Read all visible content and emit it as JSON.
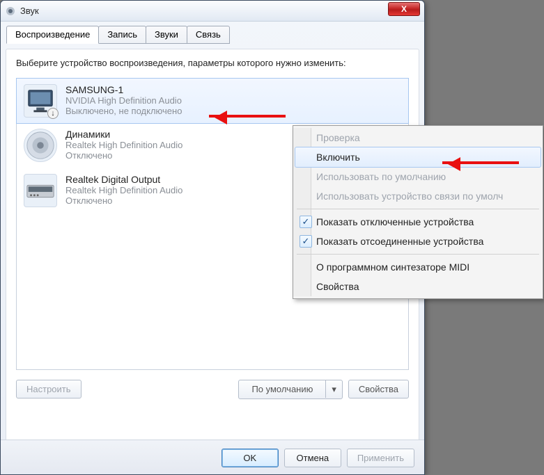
{
  "window": {
    "title": "Звук",
    "close_label": "X"
  },
  "tabs": {
    "playback": "Воспроизведение",
    "record": "Запись",
    "sounds": "Звуки",
    "comm": "Связь"
  },
  "prompt": "Выберите устройство воспроизведения, параметры которого нужно изменить:",
  "devices": [
    {
      "name": "SAMSUNG-1",
      "driver": "NVIDIA High Definition Audio",
      "status": "Выключено, не подключено",
      "icon": "monitor-icon",
      "badge": "↓"
    },
    {
      "name": "Динамики",
      "driver": "Realtek High Definition Audio",
      "status": "Отключено",
      "icon": "speaker-icon",
      "badge": ""
    },
    {
      "name": "Realtek Digital Output",
      "driver": "Realtek High Definition Audio",
      "status": "Отключено",
      "icon": "digital-out-icon",
      "badge": ""
    }
  ],
  "buttons": {
    "configure": "Настроить",
    "set_default": "По умолчанию",
    "properties": "Свойства",
    "ok": "OK",
    "cancel": "Отмена",
    "apply": "Применить"
  },
  "context_menu": {
    "test": "Проверка",
    "enable": "Включить",
    "use_default": "Использовать по умолчанию",
    "use_comm_default": "Использовать устройство связи по умолч",
    "show_disabled": "Показать отключенные устройства",
    "show_disconnected": "Показать отсоединенные устройства",
    "about_midi": "О программном синтезаторе MIDI",
    "props": "Свойства"
  }
}
